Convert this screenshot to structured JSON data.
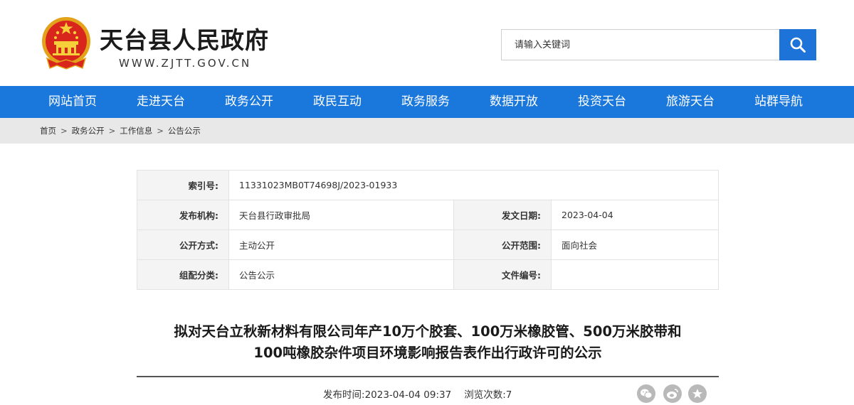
{
  "header": {
    "site_title": "天台县人民政府",
    "site_url": "WWW.ZJTT.GOV.CN",
    "emblem_icon": "national-emblem-icon",
    "search": {
      "placeholder": "请输入关键词",
      "button_icon": "search-icon"
    },
    "accent_color": "#1a77dc"
  },
  "nav": {
    "items": [
      {
        "label": "网站首页"
      },
      {
        "label": "走进天台"
      },
      {
        "label": "政务公开"
      },
      {
        "label": "政民互动"
      },
      {
        "label": "政务服务"
      },
      {
        "label": "数据开放"
      },
      {
        "label": "投资天台"
      },
      {
        "label": "旅游天台"
      },
      {
        "label": "站群导航"
      }
    ]
  },
  "breadcrumb": {
    "items": [
      "首页",
      "政务公开",
      "工作信息",
      "公告公示"
    ],
    "separator": ">"
  },
  "meta": {
    "index_label": "索引号:",
    "index_value": "11331023MB0T74698J/2023-01933",
    "publisher_label": "发布机构:",
    "publisher_value": "天台县行政审批局",
    "issue_date_label": "发文日期:",
    "issue_date_value": "2023-04-04",
    "disclosure_label": "公开方式:",
    "disclosure_value": "主动公开",
    "scope_label": "公开范围:",
    "scope_value": "面向社会",
    "category_label": "组配分类:",
    "category_value": "公告公示",
    "doc_no_label": "文件编号:",
    "doc_no_value": ""
  },
  "article": {
    "title_line1": "拟对天台立秋新材料有限公司年产10万个胶套、100万米橡胶管、500万米胶带和",
    "title_line2": "100吨橡胶杂件项目环境影响报告表作出行政许可的公示",
    "publish_time_label": "发布时间:",
    "publish_time": "2023-04-04 09:37",
    "views_label": "浏览次数:",
    "views": "7"
  },
  "share": {
    "icons": [
      "wechat-icon",
      "weibo-icon",
      "favorite-star-icon"
    ]
  }
}
